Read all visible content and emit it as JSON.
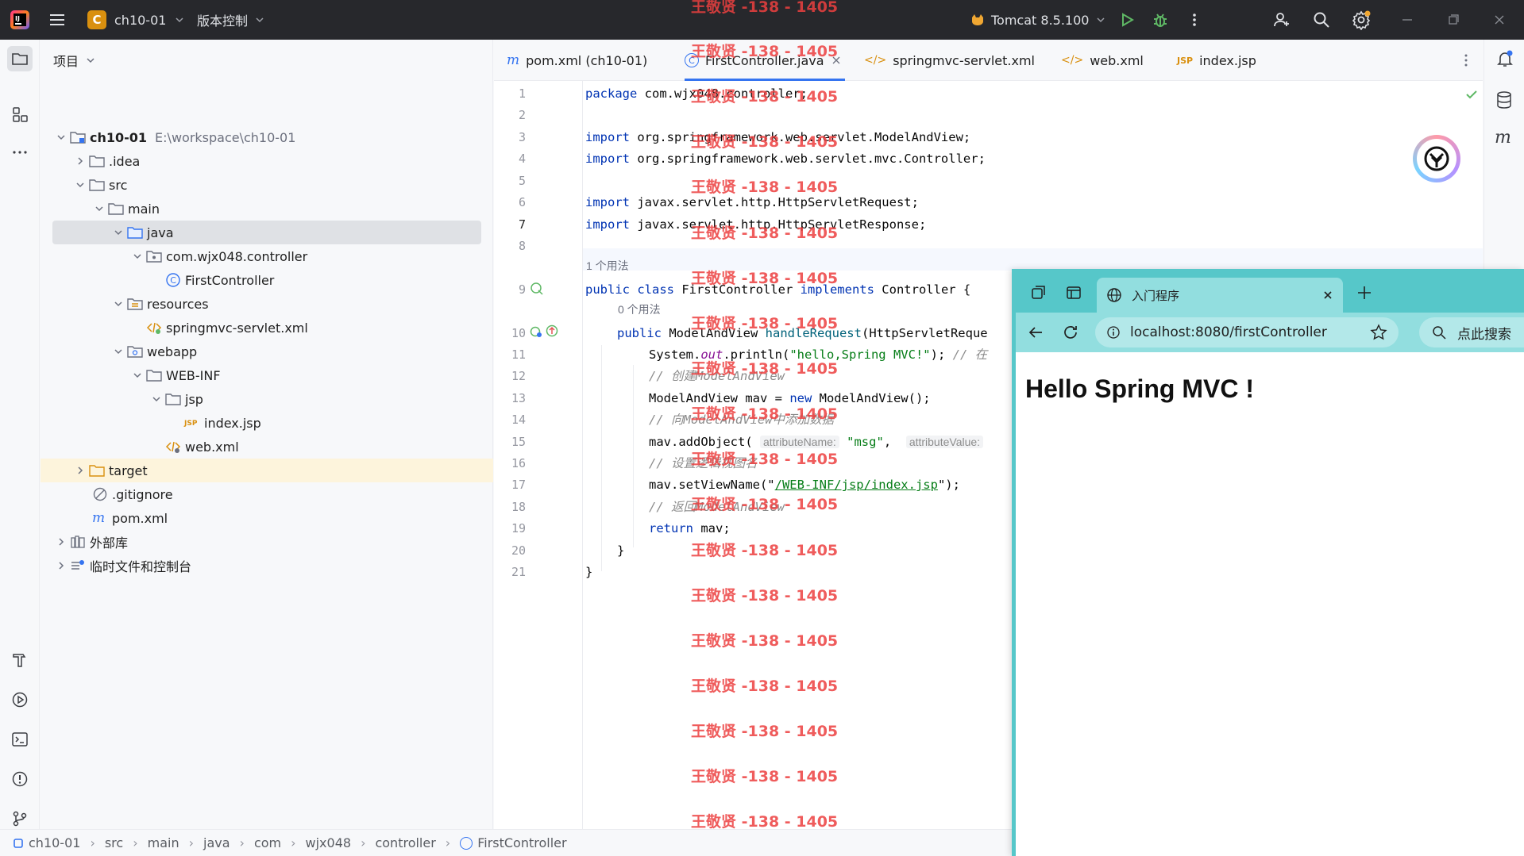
{
  "titlebar": {
    "project_badge": "C",
    "project_name": "ch10-01",
    "vcs_menu": "版本控制",
    "run_config": "Tomcat 8.5.100"
  },
  "project_panel": {
    "title": "项目",
    "tree": [
      {
        "label": "ch10-01",
        "detail": "E:\\workspace\\ch10-01"
      },
      {
        "label": ".idea"
      },
      {
        "label": "src"
      },
      {
        "label": "main"
      },
      {
        "label": "java"
      },
      {
        "label": "com.wjx048.controller"
      },
      {
        "label": "FirstController"
      },
      {
        "label": "resources"
      },
      {
        "label": "springmvc-servlet.xml"
      },
      {
        "label": "webapp"
      },
      {
        "label": "WEB-INF"
      },
      {
        "label": "jsp"
      },
      {
        "label": "index.jsp"
      },
      {
        "label": "web.xml"
      },
      {
        "label": "target"
      },
      {
        "label": ".gitignore"
      },
      {
        "label": "pom.xml"
      },
      {
        "label": "外部库"
      },
      {
        "label": "临时文件和控制台"
      }
    ]
  },
  "editor": {
    "tabs": [
      {
        "label": "pom.xml (ch10-01)",
        "icon": "m"
      },
      {
        "label": "FirstController.java",
        "icon": "C"
      },
      {
        "label": "springmvc-servlet.xml",
        "icon": "</>"
      },
      {
        "label": "web.xml",
        "icon": "</>"
      },
      {
        "label": "index.jsp",
        "icon": "JSP"
      }
    ],
    "line_numbers": [
      "1",
      "2",
      "3",
      "4",
      "5",
      "6",
      "7",
      "8",
      "9",
      "10",
      "11",
      "12",
      "13",
      "14",
      "15",
      "16",
      "17",
      "18",
      "19",
      "20",
      "21"
    ],
    "code": {
      "l1_kw": "package",
      "l1_rest": " com.wjx048.controller;",
      "l3_kw": "import",
      "l3_rest": " org.springframework.web.servlet.ModelAndView;",
      "l4_kw": "import",
      "l4_rest": " org.springframework.web.servlet.mvc.Controller;",
      "l6_kw": "import",
      "l6_rest": " javax.servlet.http.HttpServletRequest;",
      "l7_kw": "import",
      "l7_rest": " javax.servlet.http.HttpServletResponse;",
      "usage1": "1 个用法",
      "l9_kw1": "public class",
      "l9_mid": " FirstController ",
      "l9_kw2": "implements",
      "l9_rest": " Controller {",
      "usage2": "0 个用法",
      "l10_kw": "public",
      "l10_mid": " ModelAndView ",
      "l10_fn": "handleRequest",
      "l10_rest": "(HttpServletReque",
      "l11_a": "System.",
      "l11_out": "out",
      "l11_b": ".println(",
      "l11_str": "\"hello,Spring MVC!\"",
      "l11_c": "); ",
      "l11_cm": "// 在",
      "l12_cm": "// 创建ModelAndView",
      "l13_a": "ModelAndView mav = ",
      "l13_kw": "new",
      "l13_b": " ModelAndView();",
      "l14_cm": "// 向ModelAndView中添加数据",
      "l15_a": "mav.addObject( ",
      "l15_hint1": "attributeName:",
      "l15_str": " \"msg\"",
      "l15_b": ",  ",
      "l15_hint2": "attributeValue:",
      "l16_cm": "// 设置逻辑视图名",
      "l17_a": "mav.setViewName(\"",
      "l17_link": "/WEB-INF/jsp/index.jsp",
      "l17_b": "\");",
      "l18_cm": "// 返回ModelAndView",
      "l19_kw": "return",
      "l19_rest": " mav;",
      "l20": "}",
      "l21": "}"
    }
  },
  "breadcrumb": [
    "ch10-01",
    "src",
    "main",
    "java",
    "com",
    "wjx048",
    "controller",
    "FirstController"
  ],
  "browser": {
    "tab_title": "入门程序",
    "url": "localhost:8080/firstController",
    "search_label": "点此搜索",
    "heading": "Hello Spring MVC !"
  },
  "watermark": "王敬贤 -138 - 1405",
  "colors": {
    "accent": "#3574f0",
    "browser_frame": "#56c7c9",
    "keyword": "#0033b3",
    "string": "#067d17"
  }
}
